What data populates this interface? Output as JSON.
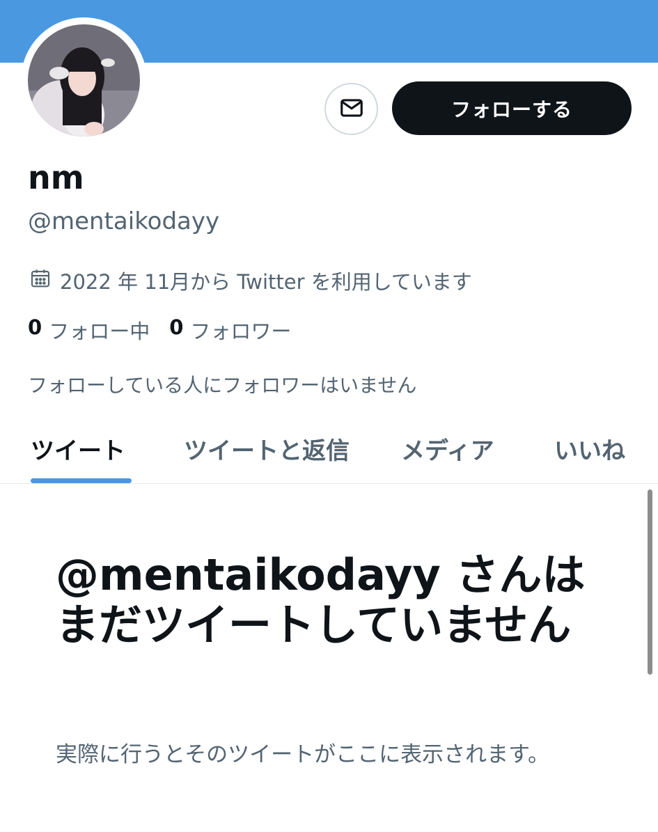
{
  "header": {
    "banner_color": "#4a98e0"
  },
  "profile": {
    "display_name": "nm",
    "handle": "@mentaikodayy",
    "joined": "2022 年 11月から Twitter を利用しています",
    "following_count": "0",
    "following_label": "フォロー中",
    "followers_count": "0",
    "followers_label": "フォロワー",
    "followed_by_note": "フォローしている人にフォロワーはいません"
  },
  "actions": {
    "message_icon": "envelope-icon",
    "follow_label": "フォローする"
  },
  "tabs": [
    {
      "label": "ツイート",
      "active": true
    },
    {
      "label": "ツイートと返信",
      "active": false
    },
    {
      "label": "メディア",
      "active": false
    },
    {
      "label": "いいね",
      "active": false
    }
  ],
  "empty_state": {
    "title": "@mentaikodayy さんはまだツイートしていません",
    "subtitle": "実際に行うとそのツイートがここに表示されます。"
  },
  "colors": {
    "accent": "#4a98e0",
    "text_primary": "#0f1419",
    "text_secondary": "#536471"
  }
}
